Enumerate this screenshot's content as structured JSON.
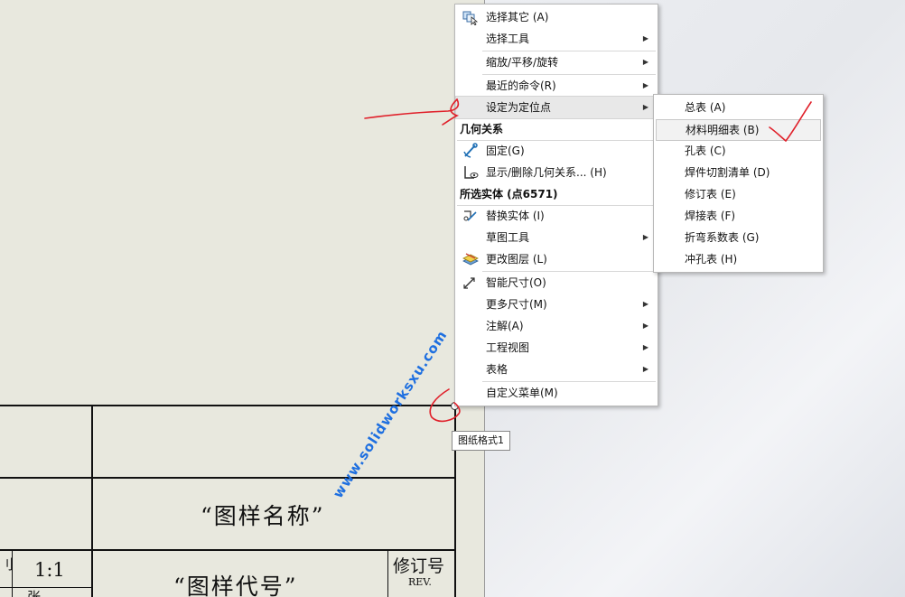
{
  "context_menu": {
    "items": [
      {
        "label": "选择其它 (A)"
      },
      {
        "label": "选择工具"
      },
      {
        "label": "缩放/平移/旋转"
      },
      {
        "label": "最近的命令(R)"
      },
      {
        "label": "设定为定位点"
      },
      {
        "label": "几何关系"
      },
      {
        "label": "固定(G)"
      },
      {
        "label": "显示/删除几何关系... (H)"
      },
      {
        "label": "所选实体 (点6571)"
      },
      {
        "label": "替换实体 (I)"
      },
      {
        "label": "草图工具"
      },
      {
        "label": "更改图层 (L)"
      },
      {
        "label": "智能尺寸(O)"
      },
      {
        "label": "更多尺寸(M)"
      },
      {
        "label": "注解(A)"
      },
      {
        "label": "工程视图"
      },
      {
        "label": "表格"
      },
      {
        "label": "自定义菜单(M)"
      }
    ]
  },
  "submenu": {
    "items": [
      {
        "label": "总表 (A)"
      },
      {
        "label": "材料明细表 (B)"
      },
      {
        "label": "孔表 (C)"
      },
      {
        "label": "焊件切割清单 (D)"
      },
      {
        "label": "修订表 (E)"
      },
      {
        "label": "焊接表 (F)"
      },
      {
        "label": "折弯系数表 (G)"
      },
      {
        "label": "冲孔表 (H)"
      }
    ]
  },
  "tooltip": "图纸格式1",
  "title_block": {
    "drawing_name": "“图样名称”",
    "drawing_code": "“图样代号”",
    "scale": "1:1",
    "rev_cn": "修订号",
    "rev_en": "REV.",
    "cut_left": "刂",
    "cut_bottom": "张"
  },
  "watermark": "www.solidworksxu.com"
}
